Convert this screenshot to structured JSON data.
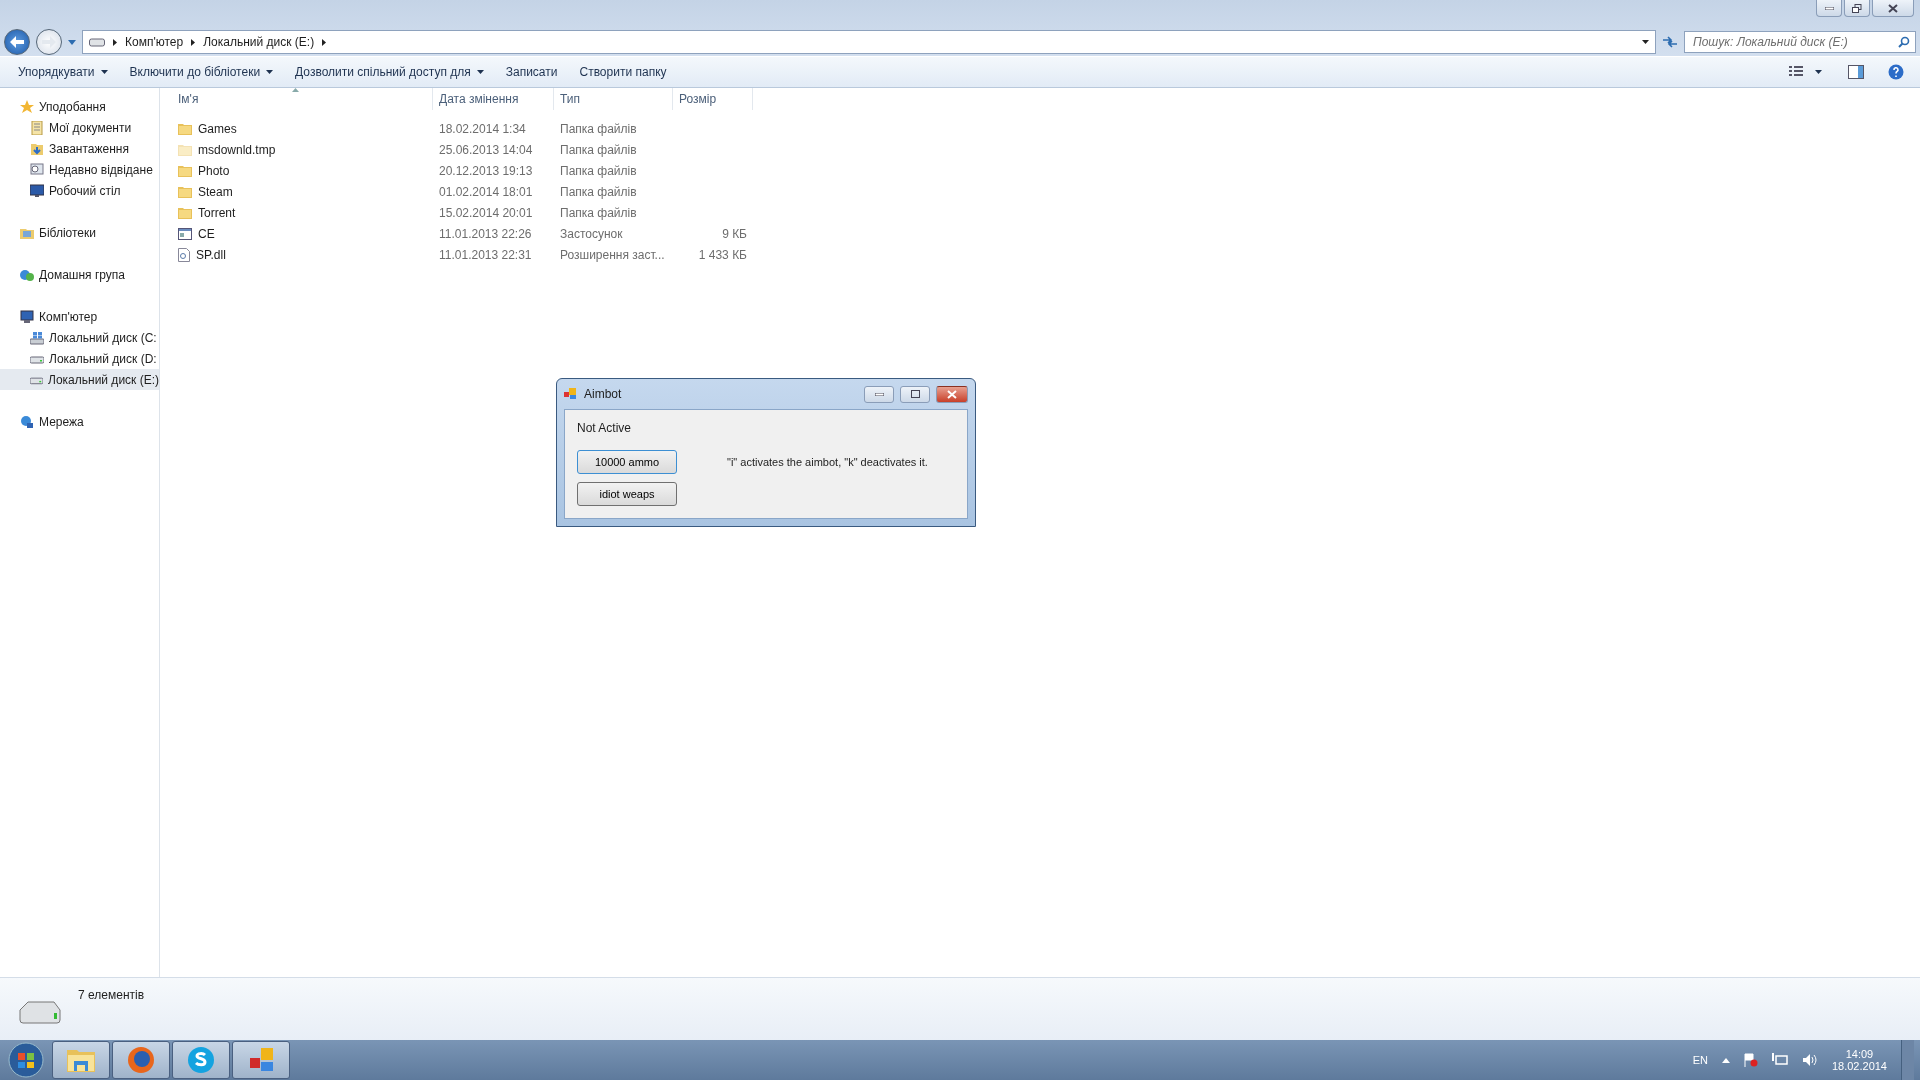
{
  "address": {
    "crumbs": [
      "Комп'ютер",
      "Локальний диск (E:)"
    ]
  },
  "search": {
    "placeholder": "Пошук: Локальний диск (E:)"
  },
  "toolbar": [
    {
      "label": "Упорядкувати",
      "dropdown": true
    },
    {
      "label": "Включити до бібліотеки",
      "dropdown": true
    },
    {
      "label": "Дозволити спільний доступ для",
      "dropdown": true
    },
    {
      "label": "Записати",
      "dropdown": false
    },
    {
      "label": "Створити папку",
      "dropdown": false
    }
  ],
  "sidebar": [
    {
      "label": "Уподобання",
      "kind": "star",
      "children": [
        {
          "label": "Мої документи",
          "kind": "docs",
          "selected": false
        },
        {
          "label": "Завантаження",
          "kind": "download",
          "selected": false
        },
        {
          "label": "Недавно відвідане",
          "kind": "recent",
          "selected": false
        },
        {
          "label": "Робочий стіл",
          "kind": "desktop",
          "selected": false
        }
      ]
    },
    {
      "label": "Бібліотеки",
      "kind": "library"
    },
    {
      "label": "Домашня група",
      "kind": "homegroup"
    },
    {
      "label": "Комп'ютер",
      "kind": "computer",
      "children": [
        {
          "label": "Локальний диск (C:",
          "kind": "sysdrive",
          "selected": false
        },
        {
          "label": "Локальний диск (D:",
          "kind": "drive",
          "selected": false
        },
        {
          "label": "Локальний диск (E:)",
          "kind": "drive",
          "selected": true
        }
      ]
    },
    {
      "label": "Мережа",
      "kind": "network"
    }
  ],
  "table": {
    "columns": [
      {
        "label": "Ім'я",
        "sorted": true
      },
      {
        "label": "Дата змінення",
        "sorted": false
      },
      {
        "label": "Тип",
        "sorted": false
      },
      {
        "label": "Розмір",
        "sorted": false
      }
    ],
    "rows": [
      {
        "kind": "folder",
        "hidden": false,
        "name": "Games",
        "date": "18.02.2014 1:34",
        "type": "Папка файлів"
      },
      {
        "kind": "folder",
        "hidden": true,
        "name": "msdownld.tmp",
        "date": "25.06.2013 14:04",
        "type": "Папка файлів"
      },
      {
        "kind": "folder",
        "hidden": false,
        "name": "Photo",
        "date": "20.12.2013 19:13",
        "type": "Папка файлів"
      },
      {
        "kind": "folder",
        "hidden": false,
        "name": "Steam",
        "date": "01.02.2014 18:01",
        "type": "Папка файлів"
      },
      {
        "kind": "folder",
        "hidden": false,
        "name": "Torrent",
        "date": "15.02.2014 20:01",
        "type": "Папка файлів"
      },
      {
        "kind": "app",
        "hidden": false,
        "name": "CE",
        "date": "11.01.2013 22:26",
        "type": "Застосунок",
        "size": "9 КБ"
      },
      {
        "kind": "dll",
        "hidden": false,
        "name": "SP.dll",
        "date": "11.01.2013 22:31",
        "type": "Розширення заст...",
        "size": "1 433 КБ"
      }
    ]
  },
  "status_bar": {
    "count": "7 елементів"
  },
  "dialog": {
    "title": "Aimbot",
    "status": "Not Active",
    "buttons": [
      {
        "label": "10000 ammo",
        "focused": true
      },
      {
        "label": "idiot weaps",
        "focused": false
      }
    ],
    "hint": "\"i\" activates the aimbot, \"k\" deactivates it."
  },
  "taskbar": {
    "apps": [
      {
        "kind": "explorer"
      },
      {
        "kind": "firefox"
      },
      {
        "kind": "skype"
      },
      {
        "kind": "tiles"
      }
    ],
    "language": "EN",
    "time": "14:09",
    "date": "18.02.2014"
  }
}
